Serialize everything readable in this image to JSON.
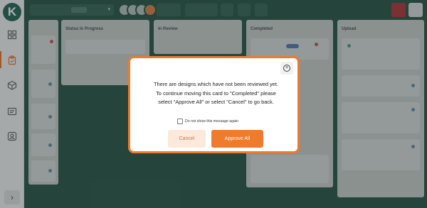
{
  "app": {
    "logo_letter": "K"
  },
  "board": {
    "columns": [
      {
        "name": "Status In Progress"
      },
      {
        "name": "In Review"
      },
      {
        "name": "Completed"
      },
      {
        "name": "Upload"
      }
    ]
  },
  "modal": {
    "message_lines": [
      "There are designs which have not been reviewed yet.",
      "To continue moving this card to \"Completed\" please",
      "select \"Approve All\" or select \"Cancel\" to go back."
    ],
    "checkbox_label": "Do not show this message again",
    "checkbox_checked": false,
    "cancel_label": "Cancel",
    "approve_label": "Approve All"
  },
  "colors": {
    "accent": "#ef7b2c",
    "accent_light": "#fde8dc",
    "board_background": "#2f5a4d",
    "sidebar_active": "#e97a35"
  },
  "icons": {
    "close": "close-icon",
    "sidebar": [
      "grid-icon",
      "clipboard-icon",
      "cube-icon",
      "badge-icon",
      "contact-icon",
      "chevron-right-icon"
    ]
  }
}
